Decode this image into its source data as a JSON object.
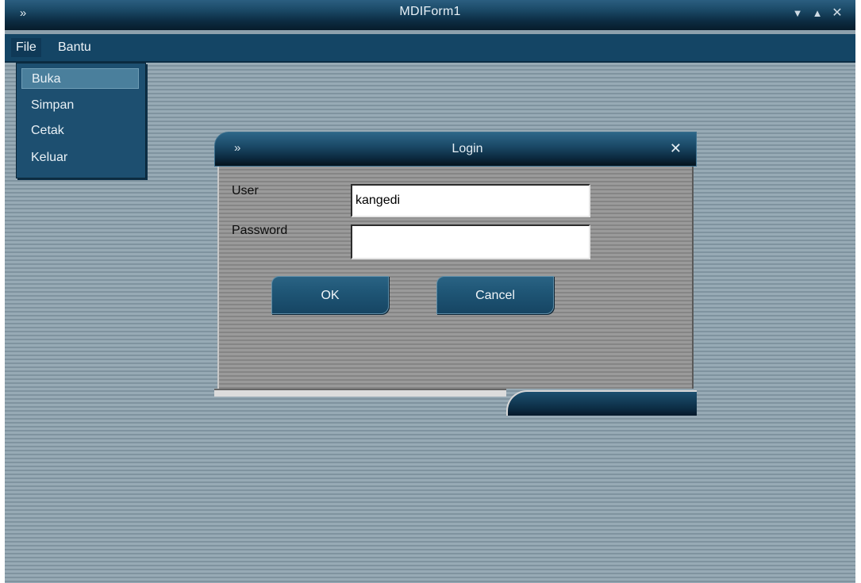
{
  "window": {
    "title": "MDIForm1",
    "sys_icon": "double-chevron-icon",
    "controls": [
      "minimize-icon",
      "maximize-icon",
      "close-icon"
    ]
  },
  "menu": {
    "items": [
      {
        "label": "File"
      },
      {
        "label": "Bantu"
      }
    ],
    "file_dropdown": [
      {
        "label": "Buka"
      },
      {
        "label": "Simpan"
      },
      {
        "label": "Cetak"
      },
      {
        "label": "Keluar"
      }
    ]
  },
  "login": {
    "title": "Login",
    "user_label": "User",
    "user_value": "kangedi",
    "password_label": "Password",
    "password_value": "",
    "ok_label": "OK",
    "cancel_label": "Cancel"
  },
  "colors": {
    "titlebar": "#0c2c42",
    "menubar": "#144565",
    "workspace": "#8ea1ad",
    "button": "#1f5676"
  }
}
